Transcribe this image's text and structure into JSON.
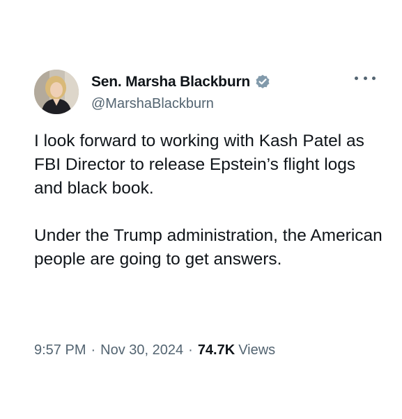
{
  "tweet": {
    "author": {
      "display_name": "Sen. Marsha Blackburn",
      "handle": "@MarshaBlackburn",
      "verified_icon": "verified-badge-icon",
      "avatar_icon": "profile-avatar"
    },
    "more_icon": "more-options-icon",
    "paragraphs": [
      "I look forward to working with Kash Patel as FBI Director to release Epstein’s flight logs and black book.",
      "Under the Trump administration, the American people are going to get answers."
    ],
    "meta": {
      "time": "9:57 PM",
      "separator": "·",
      "date": "Nov 30, 2024",
      "views_count": "74.7K",
      "views_label": "Views"
    }
  },
  "colors": {
    "text": "#0f1419",
    "secondary_text": "#536471",
    "verified_blue": "#829aab",
    "background": "#ffffff"
  }
}
